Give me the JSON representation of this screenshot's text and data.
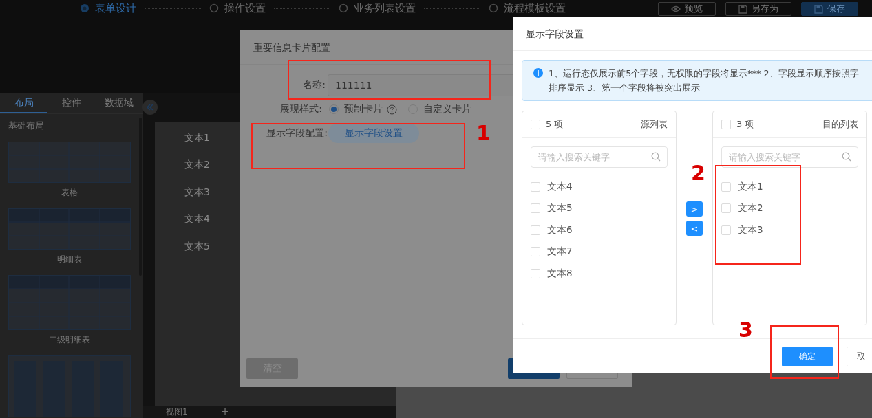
{
  "steps": [
    {
      "label": "表单设计",
      "selected": true
    },
    {
      "label": "操作设置",
      "selected": false
    },
    {
      "label": "业务列表设置",
      "selected": false
    },
    {
      "label": "流程模板设置",
      "selected": false
    }
  ],
  "header_buttons": [
    {
      "label": "预览",
      "kind": "preview"
    },
    {
      "label": "另存为",
      "kind": "saveas"
    },
    {
      "label": "保存",
      "kind": "save"
    }
  ],
  "left_panel": {
    "tabs": [
      {
        "label": "布局",
        "selected": true
      },
      {
        "label": "控件",
        "selected": false
      },
      {
        "label": "数据域",
        "selected": false
      }
    ],
    "section": "基础布局",
    "layouts": [
      {
        "label": "表格",
        "kind": "table"
      },
      {
        "label": "明细表",
        "kind": "detail"
      },
      {
        "label": "二级明细表",
        "kind": "subdetail"
      },
      {
        "kind": "columns"
      }
    ]
  },
  "canvas": {
    "fields": [
      "文本1",
      "文本2",
      "文本3",
      "文本4",
      "文本5"
    ],
    "view_tab": "视图1",
    "add_tab": "+"
  },
  "card_dialog": {
    "title": "重要信息卡片配置",
    "name_label": "名称:",
    "name_value": "111111",
    "style_label": "展现样式:",
    "style_options": [
      {
        "label": "预制卡片",
        "selected": true,
        "help": true
      },
      {
        "label": "自定义卡片",
        "selected": false,
        "help": false
      }
    ],
    "fields_label": "显示字段配置:",
    "fields_button": "显示字段设置",
    "clear_button": "清空"
  },
  "field_dialog": {
    "title": "显示字段设置",
    "notice": [
      "1、运行态仅展示前5个字段，无权限的字段将显示*** 2、字段显示顺序按照字",
      "排序显示 3、第一个字段将被突出展示"
    ],
    "source": {
      "count": "5 项",
      "title": "源列表",
      "placeholder": "请输入搜索关键字",
      "checked": false,
      "items": [
        {
          "label": "文本4",
          "checked": false
        },
        {
          "label": "文本5",
          "checked": false
        },
        {
          "label": "文本6",
          "checked": false
        },
        {
          "label": "文本7",
          "checked": false
        },
        {
          "label": "文本8",
          "checked": false
        }
      ]
    },
    "target": {
      "count": "3 项",
      "title": "目的列表",
      "placeholder": "请输入搜索关键字",
      "checked": false,
      "items": [
        {
          "label": "文本1",
          "checked": false
        },
        {
          "label": "文本2",
          "checked": false
        },
        {
          "label": "文本3",
          "checked": false
        }
      ]
    },
    "move_right": ">",
    "move_left": "<",
    "ok_button": "确定",
    "cancel_button": "取"
  },
  "annotations": [
    "1",
    "2",
    "3"
  ]
}
